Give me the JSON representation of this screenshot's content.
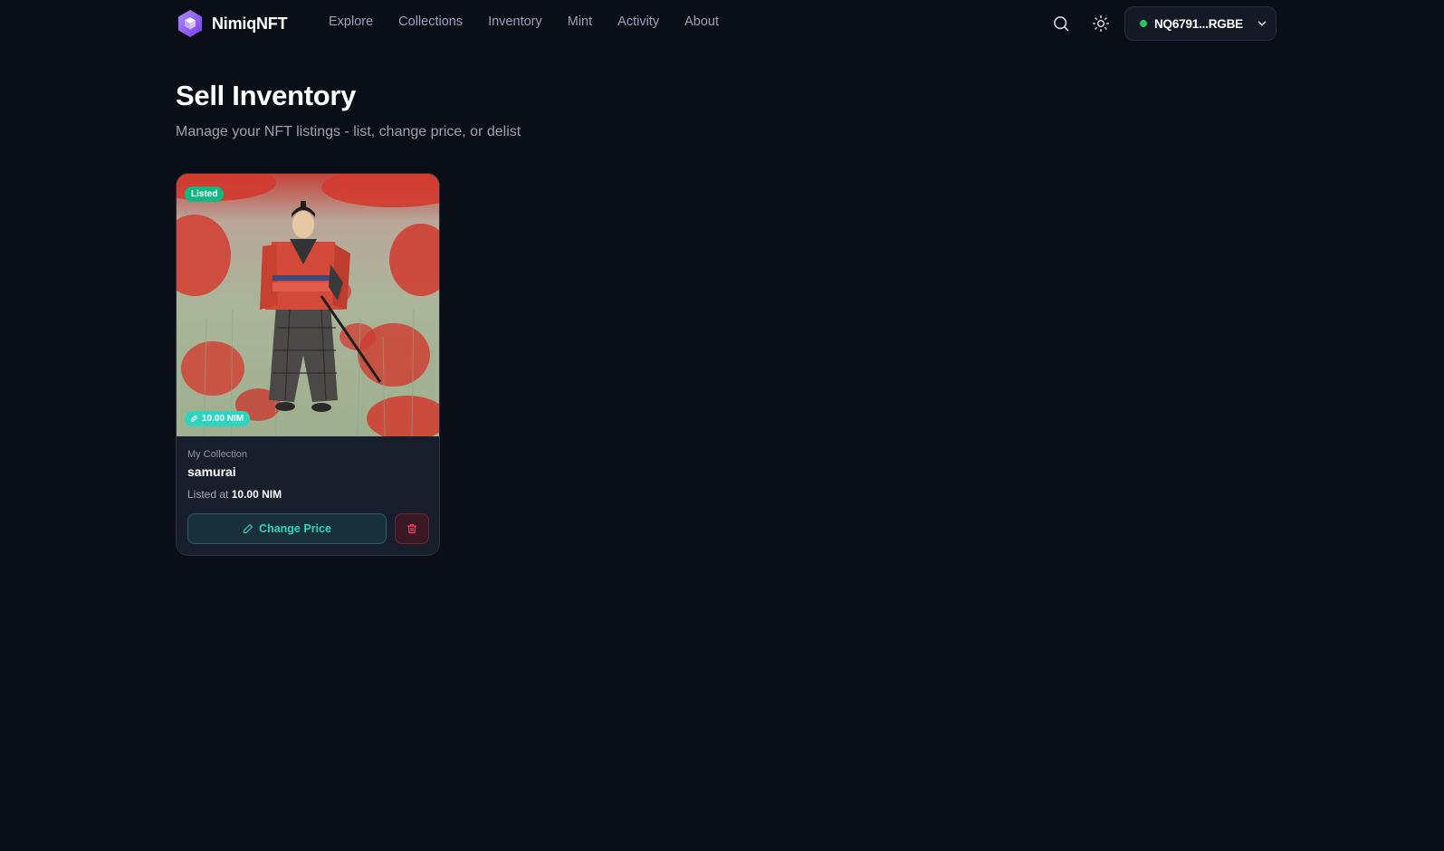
{
  "brand": {
    "name": "NimiqNFT",
    "logo_icon": "nimiq-hexagon-logo",
    "accent": "#8b5cf6"
  },
  "nav": {
    "items": [
      {
        "label": "Explore"
      },
      {
        "label": "Collections"
      },
      {
        "label": "Inventory"
      },
      {
        "label": "Mint"
      },
      {
        "label": "Activity"
      },
      {
        "label": "About"
      }
    ]
  },
  "header": {
    "search_icon": "search-icon",
    "theme_icon": "sun-icon",
    "wallet": {
      "address": "NQ6791...RGBE",
      "status_color": "#22c55e",
      "chevron_icon": "chevron-down-icon"
    }
  },
  "page": {
    "title": "Sell Inventory",
    "subtitle": "Manage your NFT listings - list, change price, or delist"
  },
  "listings": [
    {
      "status_badge": "Listed",
      "price_badge": "10.00 NIM",
      "collection": "My Collection",
      "name": "samurai",
      "listed_prefix": "Listed at",
      "listed_price": "10.00 NIM",
      "change_price_label": "Change Price",
      "delete_icon": "trash-icon"
    }
  ],
  "colors": {
    "background": "#0a0e17",
    "card": "#171f2d",
    "listed_badge": "#10b981",
    "price_badge": "#2dd4bf",
    "danger": "#f43f5e"
  }
}
